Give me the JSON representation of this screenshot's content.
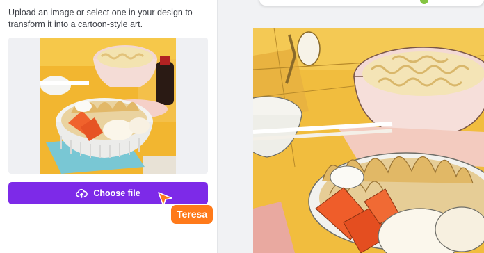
{
  "panel": {
    "description": "Upload an image or select one in your design to transform it into a cartoon-style art.",
    "choose_file_label": "Choose file",
    "upload_icon": "cloud-upload-icon"
  },
  "collaborator": {
    "name": "Teresa",
    "color": "#ff7a1a"
  },
  "theme": {
    "accent": "#7d2ae8",
    "status_dot": "#84c441"
  }
}
